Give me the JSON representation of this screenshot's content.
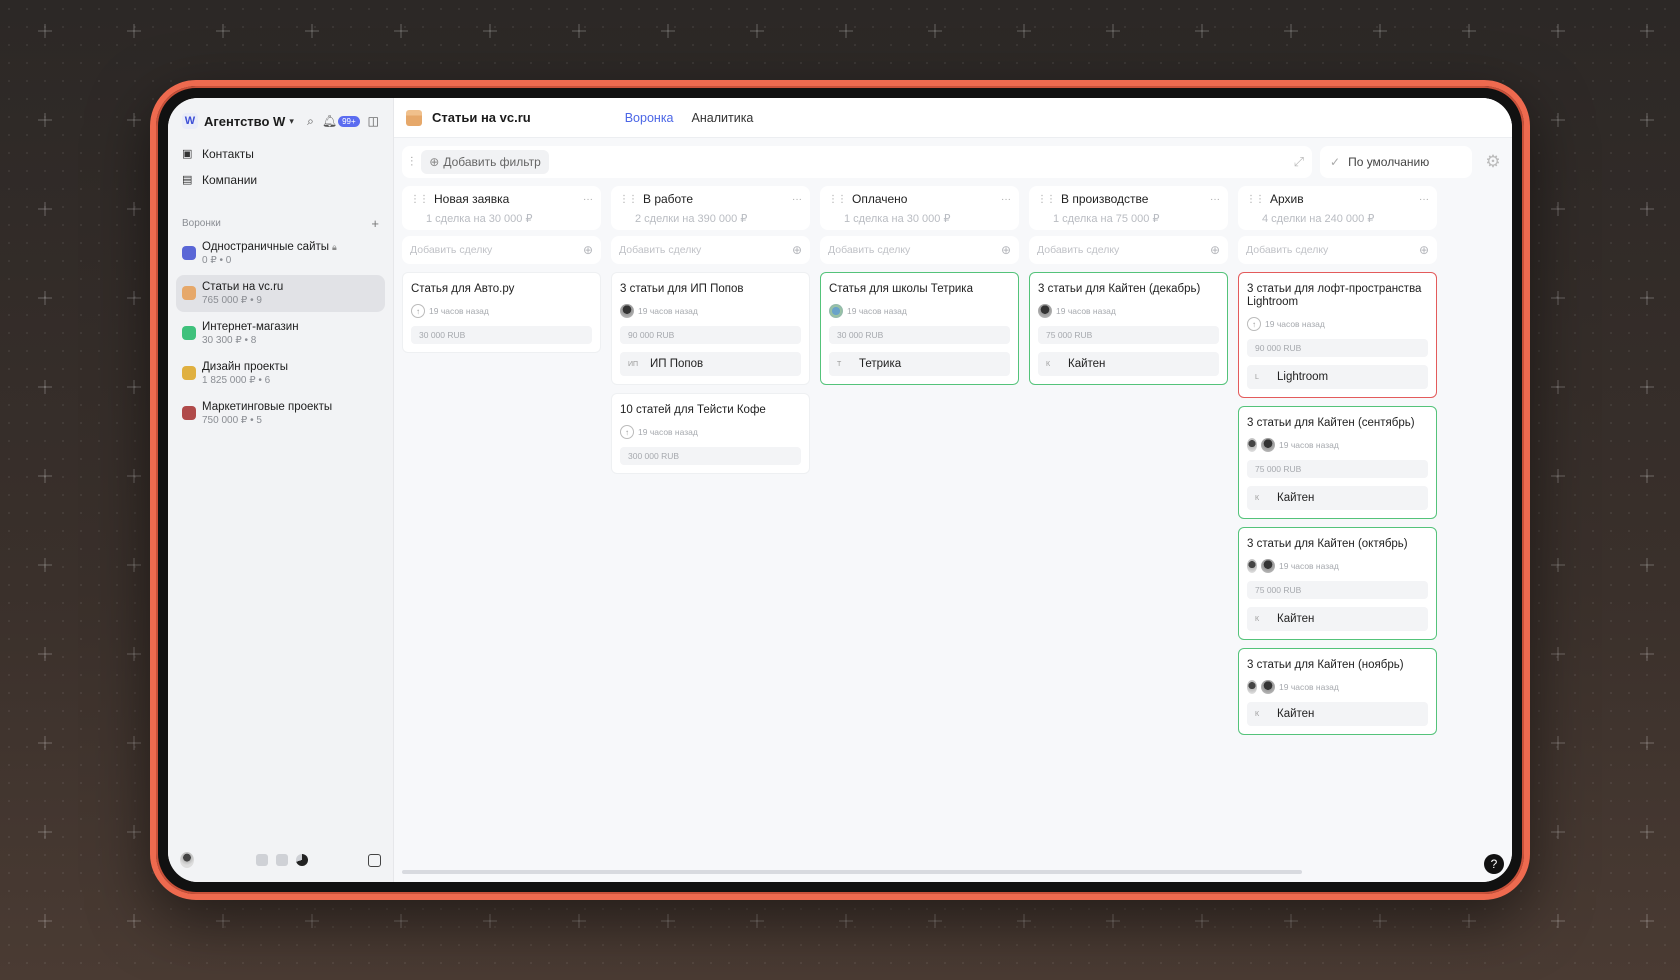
{
  "workspace": {
    "logo": "W",
    "name": "Агентство W",
    "notifications": "99+"
  },
  "sidebar": {
    "nav": [
      {
        "label": "Контакты",
        "icon": "contacts-icon"
      },
      {
        "label": "Компании",
        "icon": "companies-icon"
      }
    ],
    "funnels_label": "Воронки",
    "funnels": [
      {
        "title": "Одностраничные сайты",
        "sub": "0 ₽ • 0",
        "color": "#5a66d6",
        "locked": true
      },
      {
        "title": "Статьи на vc.ru",
        "sub": "765 000 ₽ • 9",
        "color": "#e6a86a",
        "active": true
      },
      {
        "title": "Интернет-магазин",
        "sub": "30 300 ₽ • 8",
        "color": "#3fc17c"
      },
      {
        "title": "Дизайн проекты",
        "sub": "1 825 000 ₽ • 6",
        "color": "#e0b040"
      },
      {
        "title": "Маркетинговые проекты",
        "sub": "750 000 ₽ • 5",
        "color": "#b04a4a"
      }
    ]
  },
  "board": {
    "title": "Статьи на vc.ru",
    "tabs": [
      {
        "label": "Воронка",
        "active": true
      },
      {
        "label": "Аналитика",
        "active": false
      }
    ],
    "add_filter": "Добавить фильтр",
    "default_view": "По умолчанию",
    "add_deal_placeholder": "Добавить сделку"
  },
  "columns": [
    {
      "title": "Новая заявка",
      "summary": "1 сделка на 30 000 ₽",
      "cards": [
        {
          "title": "Статья для Авто.ру",
          "avatar": "up",
          "time": "19 часов назад",
          "price": "30 000 RUB",
          "border": "none"
        }
      ]
    },
    {
      "title": "В работе",
      "summary": "2 сделки на 390 000 ₽",
      "cards": [
        {
          "title": "3 статьи для ИП Попов",
          "avatar": "person",
          "time": "19 часов назад",
          "price": "90 000 RUB",
          "company_initial": "ИП",
          "company": "ИП Попов",
          "border": "none"
        },
        {
          "title": "10 статей для Тейсти Кофе",
          "avatar": "up",
          "time": "19 часов назад",
          "price": "300 000 RUB",
          "border": "none"
        }
      ]
    },
    {
      "title": "Оплачено",
      "summary": "1 сделка на 30 000 ₽",
      "cards": [
        {
          "title": "Статья для школы Тетрика",
          "avatar": "earth",
          "time": "19 часов назад",
          "price": "30 000 RUB",
          "company_initial": "Т",
          "company": "Тетрика",
          "border": "green"
        }
      ]
    },
    {
      "title": "В производстве",
      "summary": "1 сделка на 75 000 ₽",
      "cards": [
        {
          "title": "3 статьи для Кайтен (декабрь)",
          "avatar": "person",
          "time": "19 часов назад",
          "price": "75 000 RUB",
          "company_initial": "К",
          "company": "Кайтен",
          "border": "green"
        }
      ]
    },
    {
      "title": "Архив",
      "summary": "4 сделки на 240 000 ₽",
      "cards": [
        {
          "title": "3 статьи для лофт-пространства Lightroom",
          "avatar": "up",
          "time": "19 часов назад",
          "price": "90 000 RUB",
          "company_initial": "L",
          "company": "Lightroom",
          "border": "red"
        },
        {
          "title": "3 статьи для Кайтен (сентябрь)",
          "avatar": "pair",
          "time": "19 часов назад",
          "price": "75 000 RUB",
          "company_initial": "К",
          "company": "Кайтен",
          "border": "green"
        },
        {
          "title": "3 статьи для Кайтен (октябрь)",
          "avatar": "pair",
          "time": "19 часов назад",
          "price": "75 000 RUB",
          "company_initial": "К",
          "company": "Кайтен",
          "border": "green"
        },
        {
          "title": "3 статьи для Кайтен (ноябрь)",
          "avatar": "pair",
          "time": "19 часов назад",
          "company_initial": "К",
          "company": "Кайтен",
          "border": "green"
        }
      ]
    }
  ],
  "help": "?"
}
